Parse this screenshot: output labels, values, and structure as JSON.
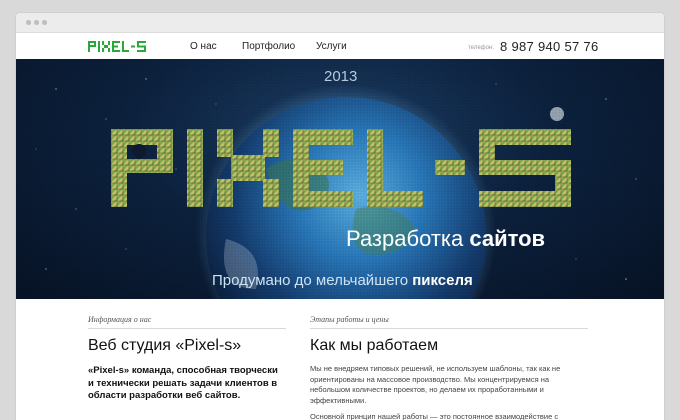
{
  "brand": {
    "logo_text": "PIXEL-S",
    "accent": "#2aa839"
  },
  "nav": {
    "items": [
      {
        "label": "О нас"
      },
      {
        "label": "Портфолио"
      },
      {
        "label": "Услуги"
      }
    ],
    "phone_label": "телефон:",
    "phone": "8 987 940 57 76"
  },
  "hero": {
    "year": "2013",
    "tagline_light": "Разработка ",
    "tagline_bold": "сайтов",
    "sub_light": "Продумано до мельчайшего ",
    "sub_bold": "пикселя"
  },
  "about": {
    "section_title": "Информация о нас",
    "heading": "Веб студия «Pixel-s»",
    "lead": "«Pixel-s» команда, способная творчески и технически решать задачи клиентов в области разработки веб сайтов."
  },
  "process": {
    "section_title": "Этапы работы и цены",
    "heading": "Как мы работаем",
    "text": "Мы не внедряем типовых решений, не используем шаблоны, так как не ориентированы на массовое производство. Мы концентрируемся на небольшом количестве проектов, но делаем их проработанными и эффективными.",
    "text2": "Основной принцип нашей работы — это постоянное взаимодействие с"
  }
}
